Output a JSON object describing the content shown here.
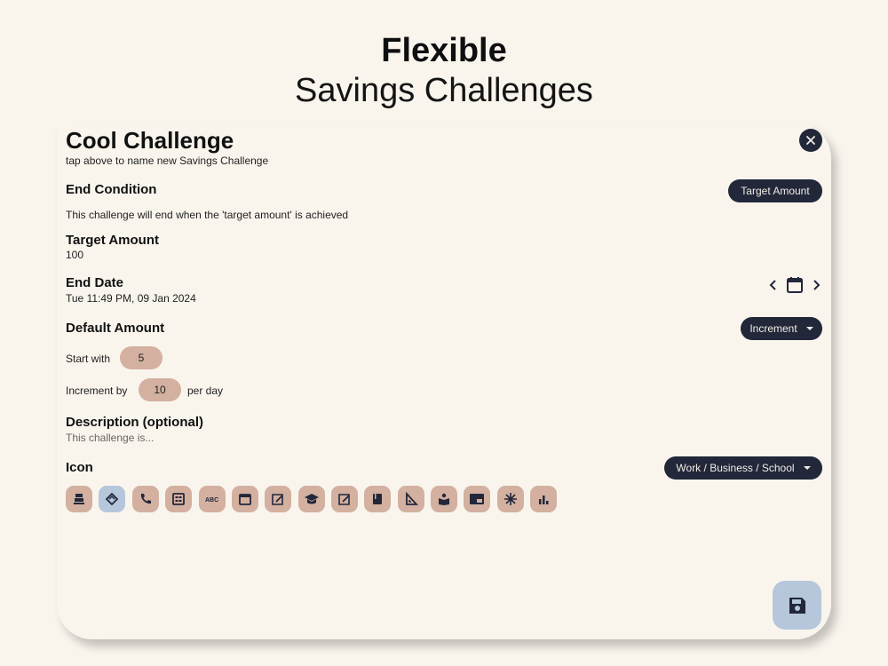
{
  "hero": {
    "line1": "Flexible",
    "line2": "Savings Challenges"
  },
  "form": {
    "title": "Cool Challenge",
    "subtitle": "tap above to name new Savings Challenge",
    "end_condition": {
      "label": "End Condition",
      "selected": "Target Amount",
      "note": "This challenge will end when the 'target amount' is achieved"
    },
    "target_amount": {
      "label": "Target Amount",
      "value": "100"
    },
    "end_date": {
      "label": "End Date",
      "value": "Tue 11:49 PM, 09 Jan 2024"
    },
    "default_amount": {
      "label": "Default Amount",
      "mode": "Increment",
      "start_label": "Start with",
      "start_value": "5",
      "increment_label": "Increment by",
      "increment_value": "10",
      "increment_suffix": "per day"
    },
    "description": {
      "label": "Description (optional)",
      "placeholder": "This challenge is..."
    },
    "icon": {
      "label": "Icon",
      "category": "Work / Business / School",
      "selected_index": 1,
      "items": [
        "cash-register-icon",
        "handshake-icon",
        "phone-icon",
        "id-card-icon",
        "abc-icon",
        "calendar-icon",
        "draft-icon",
        "graduation-cap-icon",
        "draft-icon",
        "book-icon",
        "set-square-icon",
        "reading-icon",
        "card-icon",
        "snowflake-icon",
        "bar-chart-icon"
      ]
    },
    "save_icon": "save-icon"
  },
  "colors": {
    "dark": "#22273a",
    "chip": "#d3b0a0",
    "selected": "#b6c7dc",
    "background": "#f9f5ed"
  }
}
